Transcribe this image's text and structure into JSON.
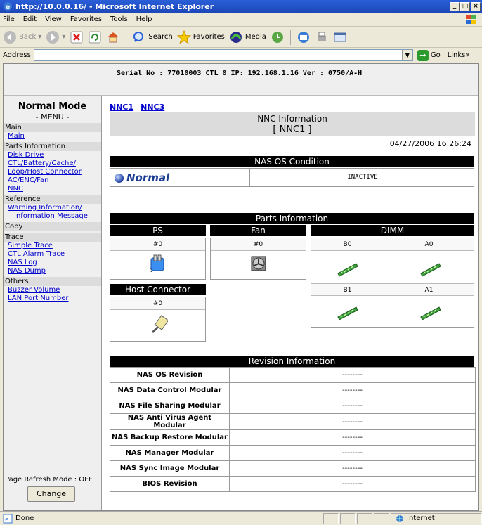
{
  "window": {
    "title": "http://10.0.0.16/ - Microsoft Internet Explorer"
  },
  "menubar": {
    "items": [
      "File",
      "Edit",
      "View",
      "Favorites",
      "Tools",
      "Help"
    ]
  },
  "toolbar": {
    "back": "Back",
    "search": "Search",
    "favorites": "Favorites",
    "media": "Media"
  },
  "address": {
    "label": "Address",
    "value": "",
    "go": "Go",
    "links": "Links"
  },
  "serial_line": "Serial No : 77010003  CTL 0  IP: 192.168.1.16  Ver : 0750/A-H",
  "sidebar": {
    "mode": "Normal Mode",
    "menu_title": "- MENU -",
    "sections": {
      "main": "Main",
      "parts": "Parts Information",
      "reference": "Reference",
      "copy": "Copy",
      "trace": "Trace",
      "others": "Others"
    },
    "links": {
      "main": "Main",
      "disk_drive": "Disk Drive",
      "ctl_battery": "CTL/Battery/Cache/",
      "loop_host": "Loop/Host Connector",
      "ac_enc_fan": "AC/ENC/Fan",
      "nnc": "NNC",
      "warning_info": "Warning Information/",
      "info_message": "Information Message",
      "simple_trace": "Simple Trace",
      "ctl_alarm": "CTL Alarm Trace",
      "nas_log": "NAS Log",
      "nas_dump": "NAS Dump",
      "buzzer": "Buzzer Volume",
      "lan_port": "LAN Port Number"
    },
    "refresh_mode": "Page Refresh Mode : OFF",
    "change_button": "Change"
  },
  "main": {
    "tabs": [
      "NNC1",
      "NNC3"
    ],
    "heading": "NNC Information",
    "subheading": "[ NNC1 ]",
    "date": "04/27/2006 16:26:24",
    "os_condition": {
      "title": "NAS OS Condition",
      "status": "Normal",
      "state": "INACTIVE"
    },
    "parts": {
      "title": "Parts Information",
      "ps": {
        "title": "PS",
        "id": "#0"
      },
      "fan": {
        "title": "Fan",
        "id": "#0"
      },
      "dimm": {
        "title": "DIMM",
        "slots": [
          "B0",
          "A0",
          "B1",
          "A1"
        ]
      },
      "host": {
        "title": "Host Connector",
        "id": "#0"
      }
    },
    "revision": {
      "title": "Revision Information",
      "rows": [
        {
          "label": "NAS OS Revision",
          "value": "--------"
        },
        {
          "label": "NAS Data Control Modular",
          "value": "--------"
        },
        {
          "label": "NAS File Sharing Modular",
          "value": "--------"
        },
        {
          "label": "NAS Anti Virus Agent Modular",
          "value": "--------"
        },
        {
          "label": "NAS Backup Restore Modular",
          "value": "--------"
        },
        {
          "label": "NAS Manager Modular",
          "value": "--------"
        },
        {
          "label": "NAS Sync Image Modular",
          "value": "--------"
        },
        {
          "label": "BIOS Revision",
          "value": "--------"
        }
      ]
    }
  },
  "status": {
    "left": "Done",
    "zone": "Internet"
  }
}
